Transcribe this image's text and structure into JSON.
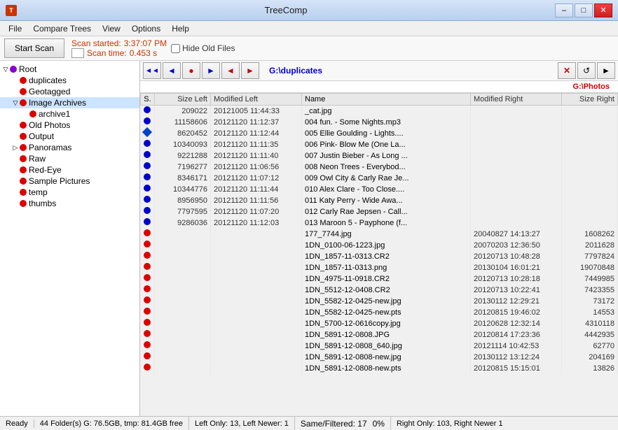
{
  "titlebar": {
    "title": "TreeComp",
    "min_label": "–",
    "max_label": "□",
    "close_label": "✕"
  },
  "menubar": {
    "items": [
      "File",
      "Compare Trees",
      "View",
      "Options",
      "Help"
    ]
  },
  "toolbar": {
    "scan_btn": "Start Scan",
    "scan_started_label": "Scan started:",
    "scan_started_value": "3:37:07 PM",
    "scan_time_label": "Scan time:",
    "scan_time_value": "0.453 s",
    "hide_old_files": "Hide Old Files"
  },
  "left_panel": {
    "path_label": "G:\\duplicates",
    "tree": [
      {
        "level": 0,
        "label": "Root",
        "type": "root",
        "expanded": true
      },
      {
        "level": 1,
        "label": "duplicates",
        "type": "red"
      },
      {
        "level": 1,
        "label": "Geotagged",
        "type": "red"
      },
      {
        "level": 1,
        "label": "Image Archives",
        "type": "red",
        "expanded": true
      },
      {
        "level": 2,
        "label": "archive1",
        "type": "red"
      },
      {
        "level": 1,
        "label": "Old Photos",
        "type": "red"
      },
      {
        "level": 1,
        "label": "Output",
        "type": "red"
      },
      {
        "level": 1,
        "label": "Panoramas",
        "type": "red",
        "expanded": false
      },
      {
        "level": 1,
        "label": "Raw",
        "type": "red"
      },
      {
        "level": 1,
        "label": "Red-Eye",
        "type": "red"
      },
      {
        "level": 1,
        "label": "Sample Pictures",
        "type": "red"
      },
      {
        "level": 1,
        "label": "temp",
        "type": "red"
      },
      {
        "level": 1,
        "label": "thumbs",
        "type": "red"
      }
    ]
  },
  "right_panel": {
    "path_left": "G:\\duplicates",
    "path_right": "G:\\Photos",
    "toolbar_buttons": [
      "◄◄",
      "◄",
      "●",
      "►",
      "►►"
    ],
    "toolbar_right_buttons": [
      "✕",
      "↺",
      "►"
    ]
  },
  "table": {
    "headers": [
      "S.",
      "Size Left",
      "Modified Left",
      "Name",
      "Modified Right",
      "Size Right"
    ],
    "rows": [
      {
        "s": "blue",
        "size_left": "209022",
        "mod_left": "20121005 11:44:33",
        "name": "_cat.jpg",
        "mod_right": "",
        "size_right": ""
      },
      {
        "s": "blue",
        "size_left": "11158606",
        "mod_left": "20121120 11:12:37",
        "name": "004 fun. - Some Nights.mp3",
        "mod_right": "",
        "size_right": ""
      },
      {
        "s": "diamond",
        "size_left": "8620452",
        "mod_left": "20121120 11:12:44",
        "name": "005 Ellie Goulding - Lights....",
        "mod_right": "",
        "size_right": ""
      },
      {
        "s": "blue",
        "size_left": "10340093",
        "mod_left": "20121120 11:11:35",
        "name": "006 Pink- Blow Me (One La...",
        "mod_right": "",
        "size_right": ""
      },
      {
        "s": "blue",
        "size_left": "9221288",
        "mod_left": "20121120 11:11:40",
        "name": "007 Justin Bieber - As Long ...",
        "mod_right": "",
        "size_right": ""
      },
      {
        "s": "blue",
        "size_left": "7196277",
        "mod_left": "20121120 11:06:56",
        "name": "008 Neon Trees - Everybod...",
        "mod_right": "",
        "size_right": ""
      },
      {
        "s": "blue",
        "size_left": "8346171",
        "mod_left": "20121120 11:07:12",
        "name": "009 Owl City & Carly Rae Je...",
        "mod_right": "",
        "size_right": ""
      },
      {
        "s": "blue",
        "size_left": "10344776",
        "mod_left": "20121120 11:11:44",
        "name": "010 Alex Clare - Too Close....",
        "mod_right": "",
        "size_right": ""
      },
      {
        "s": "blue",
        "size_left": "8956950",
        "mod_left": "20121120 11:11:56",
        "name": "011 Katy Perry - Wide Awa...",
        "mod_right": "",
        "size_right": ""
      },
      {
        "s": "blue",
        "size_left": "7797595",
        "mod_left": "20121120 11:07:20",
        "name": "012 Carly Rae Jepsen - Call...",
        "mod_right": "",
        "size_right": ""
      },
      {
        "s": "blue",
        "size_left": "9286036",
        "mod_left": "20121120 11:12:03",
        "name": "013 Maroon 5 - Payphone (f...",
        "mod_right": "",
        "size_right": ""
      },
      {
        "s": "red",
        "size_left": "",
        "mod_left": "",
        "name": "177_7744.jpg",
        "mod_right": "20040827 14:13:27",
        "size_right": "1608262"
      },
      {
        "s": "red",
        "size_left": "",
        "mod_left": "",
        "name": "1DN_0100-06-1223.jpg",
        "mod_right": "20070203 12:36:50",
        "size_right": "2011628"
      },
      {
        "s": "red",
        "size_left": "",
        "mod_left": "",
        "name": "1DN_1857-11-0313.CR2",
        "mod_right": "20120713 10:48:28",
        "size_right": "7797824"
      },
      {
        "s": "red",
        "size_left": "",
        "mod_left": "",
        "name": "1DN_1857-11-0313.png",
        "mod_right": "20130104 16:01:21",
        "size_right": "19070848"
      },
      {
        "s": "red",
        "size_left": "",
        "mod_left": "",
        "name": "1DN_4975-11-0918.CR2",
        "mod_right": "20120713 10:28:18",
        "size_right": "7449985"
      },
      {
        "s": "red",
        "size_left": "",
        "mod_left": "",
        "name": "1DN_5512-12-0408.CR2",
        "mod_right": "20120713 10:22:41",
        "size_right": "7423355"
      },
      {
        "s": "red",
        "size_left": "",
        "mod_left": "",
        "name": "1DN_5582-12-0425-new.jpg",
        "mod_right": "20130112 12:29:21",
        "size_right": "73172"
      },
      {
        "s": "red",
        "size_left": "",
        "mod_left": "",
        "name": "1DN_5582-12-0425-new.pts",
        "mod_right": "20120815 19:46:02",
        "size_right": "14553"
      },
      {
        "s": "red",
        "size_left": "",
        "mod_left": "",
        "name": "1DN_5700-12-0616copy.jpg",
        "mod_right": "20120628 12:32:14",
        "size_right": "4310118"
      },
      {
        "s": "red",
        "size_left": "",
        "mod_left": "",
        "name": "1DN_5891-12-0808.JPG",
        "mod_right": "20120814 17:23:36",
        "size_right": "4442935"
      },
      {
        "s": "red",
        "size_left": "",
        "mod_left": "",
        "name": "1DN_5891-12-0808_640.jpg",
        "mod_right": "20121114 10:42:53",
        "size_right": "62770"
      },
      {
        "s": "red",
        "size_left": "",
        "mod_left": "",
        "name": "1DN_5891-12-0808-new.jpg",
        "mod_right": "20130112 13:12:24",
        "size_right": "204169"
      },
      {
        "s": "red",
        "size_left": "",
        "mod_left": "",
        "name": "1DN_5891-12-0808-new.pts",
        "mod_right": "20120815 15:15:01",
        "size_right": "13826"
      }
    ]
  },
  "statusbar": {
    "ready": "Ready",
    "left_info": "44 Folder(s) G: 76.5GB, tmp: 81.4GB free",
    "left_only": "Left Only: 13, Left Newer: 1",
    "same": "Same/Filtered: 17",
    "right_info": "Right Only: 103, Right Newer 1",
    "progress": "0%"
  }
}
